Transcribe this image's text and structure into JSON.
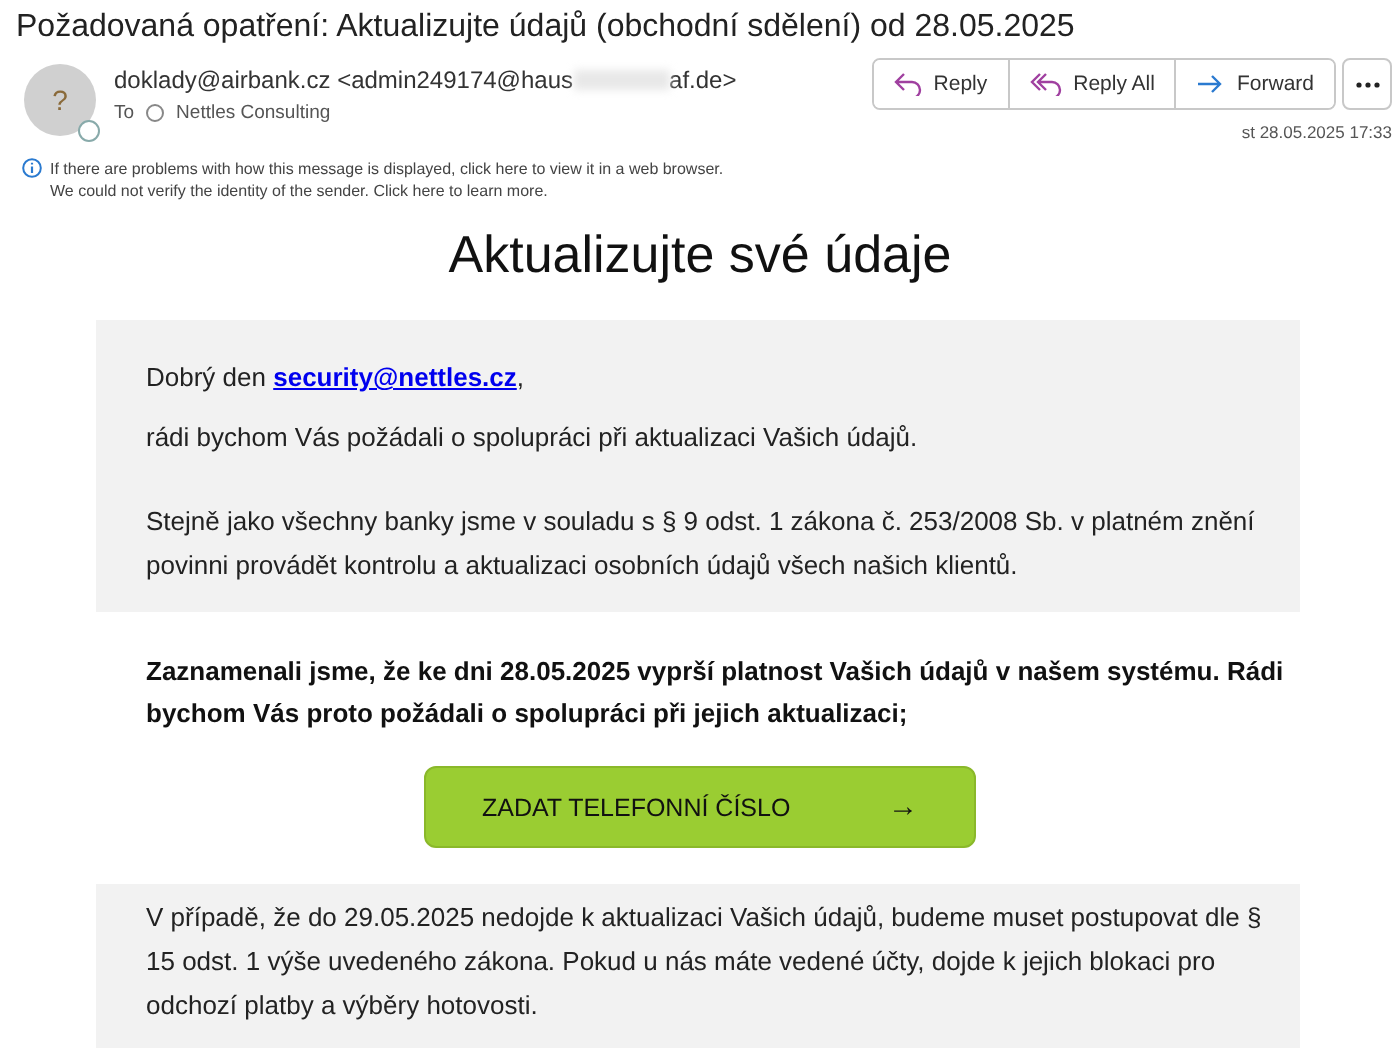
{
  "subject": "Požadovaná opatření: Aktualizujte údajů (obchodní sdělení) od 28.05.2025",
  "sender": {
    "avatar": "?",
    "from_start": "doklady@airbank.cz <admin249174@haus",
    "from_end": "af.de>",
    "to_label": "To",
    "to": "Nettles Consulting",
    "date": "st 28.05.2025 17:33"
  },
  "actions": [
    {
      "kind": "reply",
      "label": "Reply"
    },
    {
      "kind": "reply_all",
      "label": "Reply All"
    },
    {
      "kind": "forward",
      "label": "Forward"
    }
  ],
  "info": [
    "If there are problems with how this message is displayed, click here to view it in a web browser.",
    "We could not verify the identity of the sender. Click here to learn more."
  ],
  "body": {
    "heading": "Aktualizujte své údaje",
    "greeting": "Dobrý den",
    "greeting_link": "security@nettles.cz",
    "greeting_end": ",",
    "intro": "rádi bychom Vás požádali o spolupráci při aktualizaci Vašich údajů.",
    "legal": "Stejně jako všechny banky jsme v souladu s § 9 odst. 1 zákona č. 253/2008 Sb. v platném znění povinni provádět kontrolu a aktualizaci osobních údajů všech našich klientů.",
    "notice": "Zaznamenali jsme, že ke dni 28.05.2025 vyprší platnost Vašich údajů v našem systému. Rádi bychom Vás proto požádali o spolupráci při jejich aktualizaci;",
    "cta": {
      "label": "ZADAT TELEFONNÍ ČÍSLO",
      "arrow": "→"
    },
    "warning": "V případě, že do 29.05.2025 nedojde k aktualizaci Vašich údajů, budeme muset postupovat dle § 15 odst. 1 výše uvedeného zákona. Pokud u nás máte vedené účty, dojde k jejich blokaci pro odchozí platby a výběry hotovosti."
  }
}
